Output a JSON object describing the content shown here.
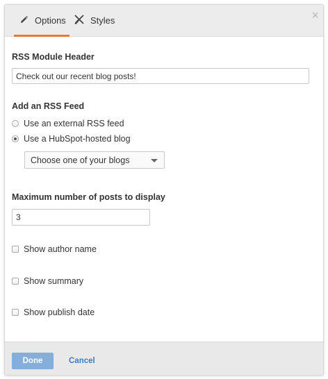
{
  "tabs": {
    "options_label": "Options",
    "styles_label": "Styles",
    "active": "Options",
    "accent_color": "#e07b39"
  },
  "close_icon": "×",
  "header_section": {
    "label": "RSS Module Header",
    "value": "Check out our recent blog posts!"
  },
  "feed_section": {
    "label": "Add an RSS Feed",
    "options": [
      {
        "label": "Use an external RSS feed",
        "checked": false
      },
      {
        "label": "Use a HubSpot-hosted blog",
        "checked": true
      }
    ],
    "blog_select": "Choose one of your blogs"
  },
  "max_posts": {
    "label": "Maximum number of posts to display",
    "value": "3"
  },
  "checkboxes": [
    {
      "label": "Show author name",
      "checked": false
    },
    {
      "label": "Show summary",
      "checked": false
    },
    {
      "label": "Show publish date",
      "checked": false
    }
  ],
  "footer": {
    "done_label": "Done",
    "cancel_label": "Cancel",
    "done_color": "#85aedb",
    "cancel_color": "#3f7bc1"
  }
}
